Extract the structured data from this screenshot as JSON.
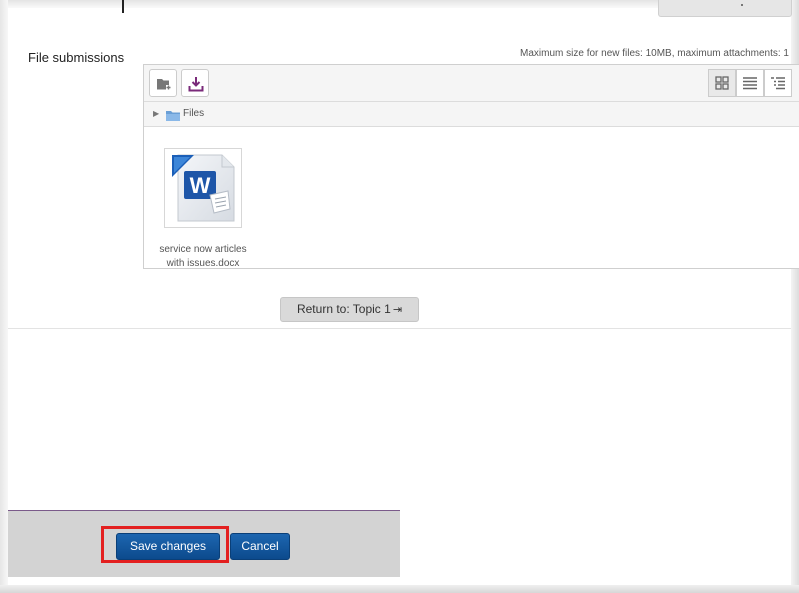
{
  "form": {
    "file_submissions_label": "File submissions",
    "max_size_text": "Maximum size for new files: 10MB, maximum attachments: 1"
  },
  "filepicker": {
    "toolbar": {
      "add_icon": "add-folder-icon",
      "download_icon": "download-icon",
      "view_icons": [
        "grid-view-icon",
        "list-view-icon",
        "tree-view-icon"
      ]
    },
    "path": {
      "folder_label": "Files"
    },
    "files": [
      {
        "name": "service now articles with issues.docx",
        "icon": "word-document-icon"
      }
    ]
  },
  "navigation": {
    "return_label": "Return to: Topic 1"
  },
  "actions": {
    "save_label": "Save changes",
    "cancel_label": "Cancel"
  },
  "colors": {
    "primary_button": "#0f55a0",
    "highlight": "#e32020",
    "download_icon": "#7a2a7a"
  }
}
